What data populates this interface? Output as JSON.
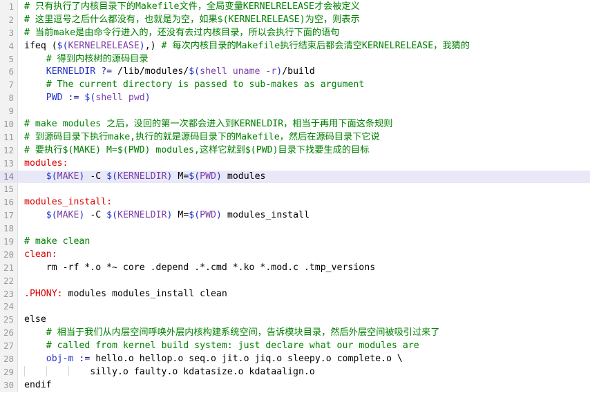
{
  "editor": {
    "type": "code-editor",
    "language": "Makefile",
    "current_line": 14,
    "total_lines_visible": 30,
    "colors": {
      "background": "#ffffff",
      "gutter_background": "#f2f2f2",
      "gutter_text": "#9a9a9a",
      "current_line_background": "#e8e8f8",
      "comment": "#008000",
      "target": "#dd0000",
      "variable": "#2233cc",
      "variable_name": "#7a3fa8",
      "plain_text": "#000000"
    }
  },
  "lines": [
    {
      "num": "1",
      "text": "# 只有执行了内核目录下的Makefile文件，全局变量KERNELRELEASE才会被定义",
      "tokens": [
        {
          "cls": "cm",
          "t": "# 只有执行了内核目录下的Makefile文件，全局变量KERNELRELEASE才会被定义"
        }
      ]
    },
    {
      "num": "2",
      "text": "# 这里逗号之后什么都没有，也就是为空，如果$(KERNELRELEASE)为空，则表示",
      "tokens": [
        {
          "cls": "cm",
          "t": "# 这里逗号之后什么都没有，也就是为空，如果$(KERNELRELEASE)为空，则表示"
        }
      ]
    },
    {
      "num": "3",
      "text": "# 当前make是由命令行进入的，还没有去过内核目录，所以会执行下面的语句",
      "tokens": [
        {
          "cls": "cm",
          "t": "# 当前make是由命令行进入的，还没有去过内核目录，所以会执行下面的语句"
        }
      ]
    },
    {
      "num": "4",
      "text": "ifeq ($(KERNELRELEASE),) # 每次内核目录的Makefile执行结束后都会清空KERNELRELEASE，我猜的",
      "tokens": [
        {
          "cls": "kw",
          "t": "ifeq ("
        },
        {
          "cls": "var",
          "t": "$("
        },
        {
          "cls": "vn",
          "t": "KERNELRELEASE"
        },
        {
          "cls": "var",
          "t": ")"
        },
        {
          "cls": "pl",
          "t": ",) "
        },
        {
          "cls": "cm",
          "t": "# 每次内核目录的Makefile执行结束后都会清空KERNELRELEASE，我猜的"
        }
      ]
    },
    {
      "num": "5",
      "text": "    # 得到内核树的源码目录",
      "tokens": [
        {
          "cls": "pl",
          "t": "    "
        },
        {
          "cls": "cm",
          "t": "# 得到内核树的源码目录"
        }
      ]
    },
    {
      "num": "6",
      "text": "    KERNELDIR ?= /lib/modules/$(shell uname -r)/build",
      "tokens": [
        {
          "cls": "pl",
          "t": "    "
        },
        {
          "cls": "var",
          "t": "KERNELDIR"
        },
        {
          "cls": "pl",
          "t": " "
        },
        {
          "cls": "op",
          "t": "?="
        },
        {
          "cls": "pl",
          "t": " /lib/modules/"
        },
        {
          "cls": "var",
          "t": "$("
        },
        {
          "cls": "vn",
          "t": "shell uname -r"
        },
        {
          "cls": "var",
          "t": ")"
        },
        {
          "cls": "pl",
          "t": "/build"
        }
      ]
    },
    {
      "num": "7",
      "text": "    # The current directory is passed to sub-makes as argument",
      "tokens": [
        {
          "cls": "pl",
          "t": "    "
        },
        {
          "cls": "cm",
          "t": "# The current directory is passed to sub-makes as argument"
        }
      ]
    },
    {
      "num": "8",
      "text": "    PWD := $(shell pwd)",
      "tokens": [
        {
          "cls": "pl",
          "t": "    "
        },
        {
          "cls": "var",
          "t": "PWD"
        },
        {
          "cls": "pl",
          "t": " "
        },
        {
          "cls": "op",
          "t": ":="
        },
        {
          "cls": "pl",
          "t": " "
        },
        {
          "cls": "var",
          "t": "$("
        },
        {
          "cls": "vn",
          "t": "shell pwd"
        },
        {
          "cls": "var",
          "t": ")"
        }
      ]
    },
    {
      "num": "9",
      "text": "",
      "tokens": []
    },
    {
      "num": "10",
      "text": "# make modules 之后，没回的第一次都会进入到KERNELDIR，相当于再用下面这条规则",
      "tokens": [
        {
          "cls": "cm",
          "t": "# make modules 之后，没回的第一次都会进入到KERNELDIR，相当于再用下面这条规则"
        }
      ]
    },
    {
      "num": "11",
      "text": "# 到源码目录下执行make,执行的就是源码目录下的Makefile，然后在源码目录下它说",
      "tokens": [
        {
          "cls": "cm",
          "t": "# 到源码目录下执行make,执行的就是源码目录下的Makefile，然后在源码目录下它说"
        }
      ]
    },
    {
      "num": "12",
      "text": "# 要执行$(MAKE) M=$(PWD) modules,这样它就到$(PWD)目录下找要生成的目标",
      "tokens": [
        {
          "cls": "cm",
          "t": "# 要执行$(MAKE) M=$(PWD) modules,这样它就到$(PWD)目录下找要生成的目标"
        }
      ]
    },
    {
      "num": "13",
      "text": "modules:",
      "tokens": [
        {
          "cls": "tgt",
          "t": "modules:"
        }
      ]
    },
    {
      "num": "14",
      "text": "    $(MAKE) -C $(KERNELDIR) M=$(PWD) modules",
      "current": true,
      "tokens": [
        {
          "cls": "pl",
          "t": "    "
        },
        {
          "cls": "var",
          "t": "$("
        },
        {
          "cls": "vn",
          "t": "MAKE"
        },
        {
          "cls": "var",
          "t": ")"
        },
        {
          "cls": "pl",
          "t": " -C "
        },
        {
          "cls": "var",
          "t": "$("
        },
        {
          "cls": "vn",
          "t": "KERNELDIR"
        },
        {
          "cls": "var",
          "t": ")"
        },
        {
          "cls": "pl",
          "t": " M="
        },
        {
          "cls": "var",
          "t": "$("
        },
        {
          "cls": "vn",
          "t": "PWD"
        },
        {
          "cls": "var",
          "t": ")"
        },
        {
          "cls": "pl",
          "t": " modules"
        }
      ]
    },
    {
      "num": "15",
      "text": "",
      "tokens": []
    },
    {
      "num": "16",
      "text": "modules_install:",
      "tokens": [
        {
          "cls": "tgt",
          "t": "modules_install:"
        }
      ]
    },
    {
      "num": "17",
      "text": "    $(MAKE) -C $(KERNELDIR) M=$(PWD) modules_install",
      "tokens": [
        {
          "cls": "pl",
          "t": "    "
        },
        {
          "cls": "var",
          "t": "$("
        },
        {
          "cls": "vn",
          "t": "MAKE"
        },
        {
          "cls": "var",
          "t": ")"
        },
        {
          "cls": "pl",
          "t": " -C "
        },
        {
          "cls": "var",
          "t": "$("
        },
        {
          "cls": "vn",
          "t": "KERNELDIR"
        },
        {
          "cls": "var",
          "t": ")"
        },
        {
          "cls": "pl",
          "t": " M="
        },
        {
          "cls": "var",
          "t": "$("
        },
        {
          "cls": "vn",
          "t": "PWD"
        },
        {
          "cls": "var",
          "t": ")"
        },
        {
          "cls": "pl",
          "t": " modules_install"
        }
      ]
    },
    {
      "num": "18",
      "text": "",
      "tokens": []
    },
    {
      "num": "19",
      "text": "# make clean",
      "tokens": [
        {
          "cls": "cm",
          "t": "# make clean"
        }
      ]
    },
    {
      "num": "20",
      "text": "clean:",
      "tokens": [
        {
          "cls": "tgt",
          "t": "clean:"
        }
      ]
    },
    {
      "num": "21",
      "text": "    rm -rf *.o *~ core .depend .*.cmd *.ko *.mod.c .tmp_versions",
      "tokens": [
        {
          "cls": "pl",
          "t": "    rm -rf *.o *~ core .depend .*.cmd *.ko *.mod.c .tmp_versions"
        }
      ]
    },
    {
      "num": "22",
      "text": "",
      "tokens": []
    },
    {
      "num": "23",
      "text": ".PHONY: modules modules_install clean",
      "tokens": [
        {
          "cls": "tgt",
          "t": ".PHONY:"
        },
        {
          "cls": "pl",
          "t": " modules modules_install clean"
        }
      ]
    },
    {
      "num": "24",
      "text": "",
      "tokens": []
    },
    {
      "num": "25",
      "text": "else",
      "tokens": [
        {
          "cls": "kw",
          "t": "else"
        }
      ]
    },
    {
      "num": "26",
      "text": "    # 相当于我们从内层空间呼唤外层内核构建系统空间，告诉模块目录，然后外层空间被吸引过来了",
      "tokens": [
        {
          "cls": "pl",
          "t": "    "
        },
        {
          "cls": "cm",
          "t": "# 相当于我们从内层空间呼唤外层内核构建系统空间，告诉模块目录，然后外层空间被吸引过来了"
        }
      ]
    },
    {
      "num": "27",
      "text": "    # called from kernel build system: just declare what our modules are",
      "tokens": [
        {
          "cls": "pl",
          "t": "    "
        },
        {
          "cls": "cm",
          "t": "# called from kernel build system: just declare what our modules are"
        }
      ]
    },
    {
      "num": "28",
      "text": "    obj-m := hello.o hellop.o seq.o jit.o jiq.o sleepy.o complete.o \\",
      "tokens": [
        {
          "cls": "pl",
          "t": "    "
        },
        {
          "cls": "var",
          "t": "obj-m"
        },
        {
          "cls": "pl",
          "t": " "
        },
        {
          "cls": "op",
          "t": ":="
        },
        {
          "cls": "pl",
          "t": " hello.o hellop.o seq.o jit.o jiq.o sleepy.o complete.o \\"
        }
      ]
    },
    {
      "num": "29",
      "text": "            silly.o faulty.o kdatasize.o kdataalign.o",
      "indent_guides": 3,
      "tokens": [
        {
          "cls": "pl",
          "t": "silly.o faulty.o kdatasize.o kdataalign.o"
        }
      ]
    },
    {
      "num": "30",
      "text": "endif",
      "tokens": [
        {
          "cls": "kw",
          "t": "endif"
        }
      ]
    }
  ]
}
